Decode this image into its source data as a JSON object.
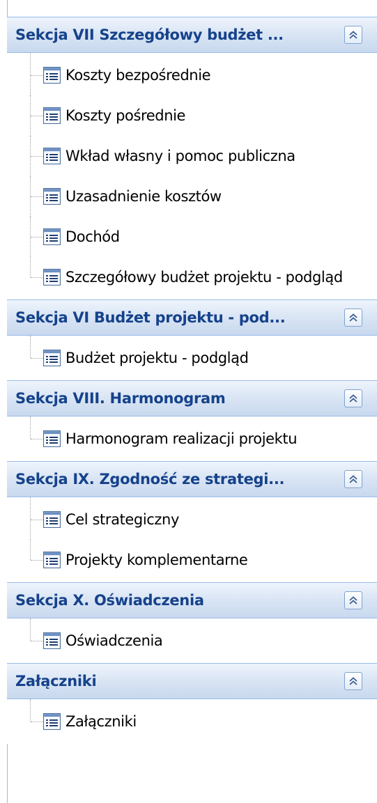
{
  "colors": {
    "header_text": "#15428b",
    "header_border": "#99bbe8",
    "item_text": "#000000"
  },
  "sections": [
    {
      "title": "Sekcja VII Szczegółowy budżet ...",
      "collapse_icon": "chevron-double-up-icon",
      "items": [
        {
          "label": "Koszty bezpośrednie",
          "icon": "form-icon"
        },
        {
          "label": "Koszty pośrednie",
          "icon": "form-icon"
        },
        {
          "label": "Wkład własny i pomoc publiczna",
          "icon": "form-icon"
        },
        {
          "label": "Uzasadnienie kosztów",
          "icon": "form-icon"
        },
        {
          "label": "Dochód",
          "icon": "form-icon"
        },
        {
          "label": "Szczegółowy budżet projektu - podgląd",
          "icon": "form-icon"
        }
      ]
    },
    {
      "title": "Sekcja VI Budżet projektu - pod...",
      "collapse_icon": "chevron-double-up-icon",
      "items": [
        {
          "label": "Budżet projektu - podgląd",
          "icon": "form-icon"
        }
      ]
    },
    {
      "title": "Sekcja VIII. Harmonogram",
      "collapse_icon": "chevron-double-up-icon",
      "items": [
        {
          "label": "Harmonogram realizacji projektu",
          "icon": "form-icon"
        }
      ]
    },
    {
      "title": "Sekcja IX. Zgodność ze strategi...",
      "collapse_icon": "chevron-double-up-icon",
      "items": [
        {
          "label": "Cel strategiczny",
          "icon": "form-icon"
        },
        {
          "label": "Projekty komplementarne",
          "icon": "form-icon"
        }
      ]
    },
    {
      "title": "Sekcja X. Oświadczenia",
      "collapse_icon": "chevron-double-up-icon",
      "items": [
        {
          "label": "Oświadczenia",
          "icon": "form-icon"
        }
      ]
    },
    {
      "title": "Załączniki",
      "collapse_icon": "chevron-double-up-icon",
      "items": [
        {
          "label": "Załączniki",
          "icon": "form-icon"
        }
      ]
    }
  ]
}
